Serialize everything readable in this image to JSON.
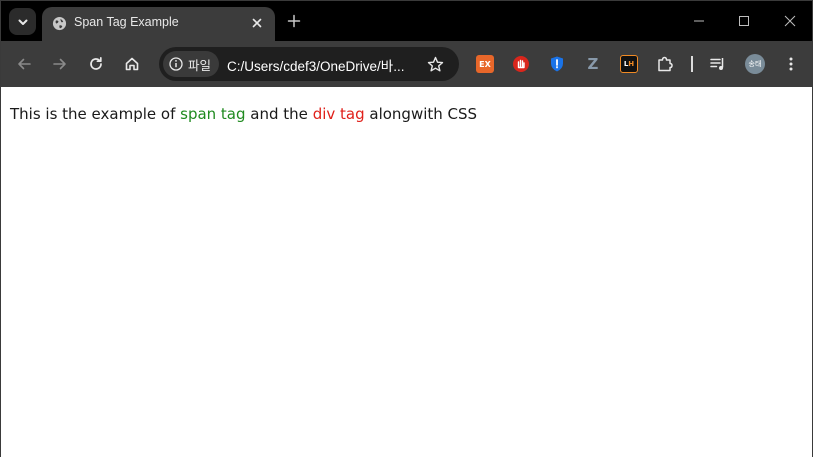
{
  "browser": {
    "tab": {
      "title": "Span Tag Example",
      "favicon": "globe-icon"
    },
    "address_bar": {
      "site_chip_label": "파일",
      "url": "C:/Users/cdef3/OneDrive/바..."
    },
    "avatar_label": "송태",
    "extensions": [
      "ex-extension",
      "hand-extension",
      "shield-extension",
      "z-extension",
      "lh-extension",
      "puzzle-icon"
    ],
    "colors": {
      "tabbar_bg": "#000000",
      "toolbar_bg": "#3c3c3c",
      "omnibox_bg": "#1f1f1f"
    }
  },
  "page": {
    "sentence": {
      "part1": "This is the example of ",
      "span_text": "span tag",
      "part2": " and the ",
      "div_text": "div tag",
      "part3": " alongwith CSS"
    },
    "colors": {
      "span_color": "#1f8a1f",
      "div_color": "#e0201a"
    }
  }
}
